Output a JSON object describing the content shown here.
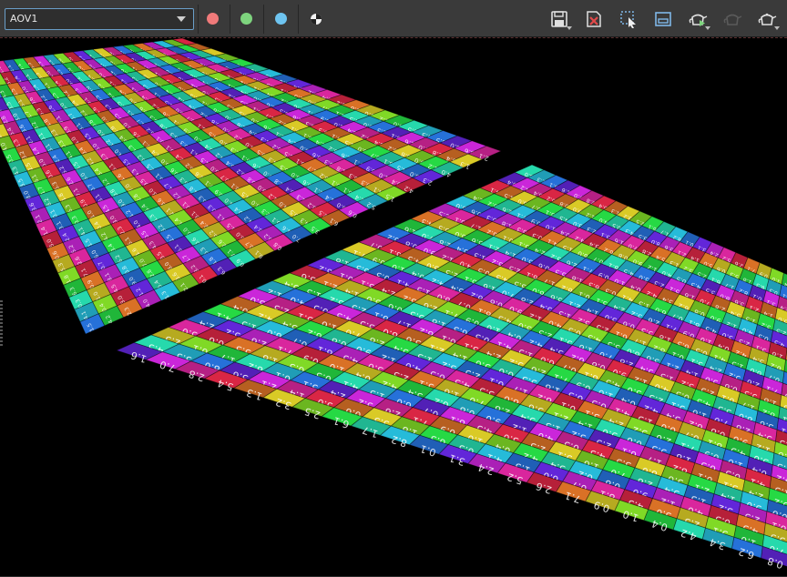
{
  "aov_select": {
    "value": "AOV1"
  },
  "channels": [
    {
      "name": "red-channel",
      "color": "#f07a7a"
    },
    {
      "name": "green-channel",
      "color": "#7ed47e"
    },
    {
      "name": "blue-channel",
      "color": "#6ec4f0"
    }
  ],
  "toolbar_icons": [
    "rgba-toggle-icon",
    "save-image-icon",
    "clear-image-icon",
    "region-select-icon",
    "crop-region-icon",
    "render-teapot-icon",
    "pause-render-icon",
    "teapot-options-icon"
  ],
  "viewport": {
    "scene": "two uv-checker textured planes",
    "tile_labels": [
      "0.1",
      "1.0",
      "1.2",
      "2.1",
      "0.3",
      "3.0",
      "1.3",
      "3.1",
      "0.4",
      "4.0",
      "1.4",
      "4.1",
      "2.3",
      "3.2",
      "2.4",
      "4.2",
      "0.5",
      "5.0",
      "1.5",
      "5.1",
      "2.5",
      "5.2",
      "3.4",
      "4.3",
      "0.6",
      "6.0",
      "1.6",
      "6.1",
      "2.6",
      "6.2",
      "3.5",
      "5.3",
      "0.7",
      "7.0",
      "1.7",
      "7.1",
      "0.8",
      "8.0",
      "1.8",
      "8.1",
      "2.8",
      "8.2",
      "0.9",
      "9.0",
      "3.6",
      "6.3",
      "4.5",
      "5.4"
    ]
  }
}
